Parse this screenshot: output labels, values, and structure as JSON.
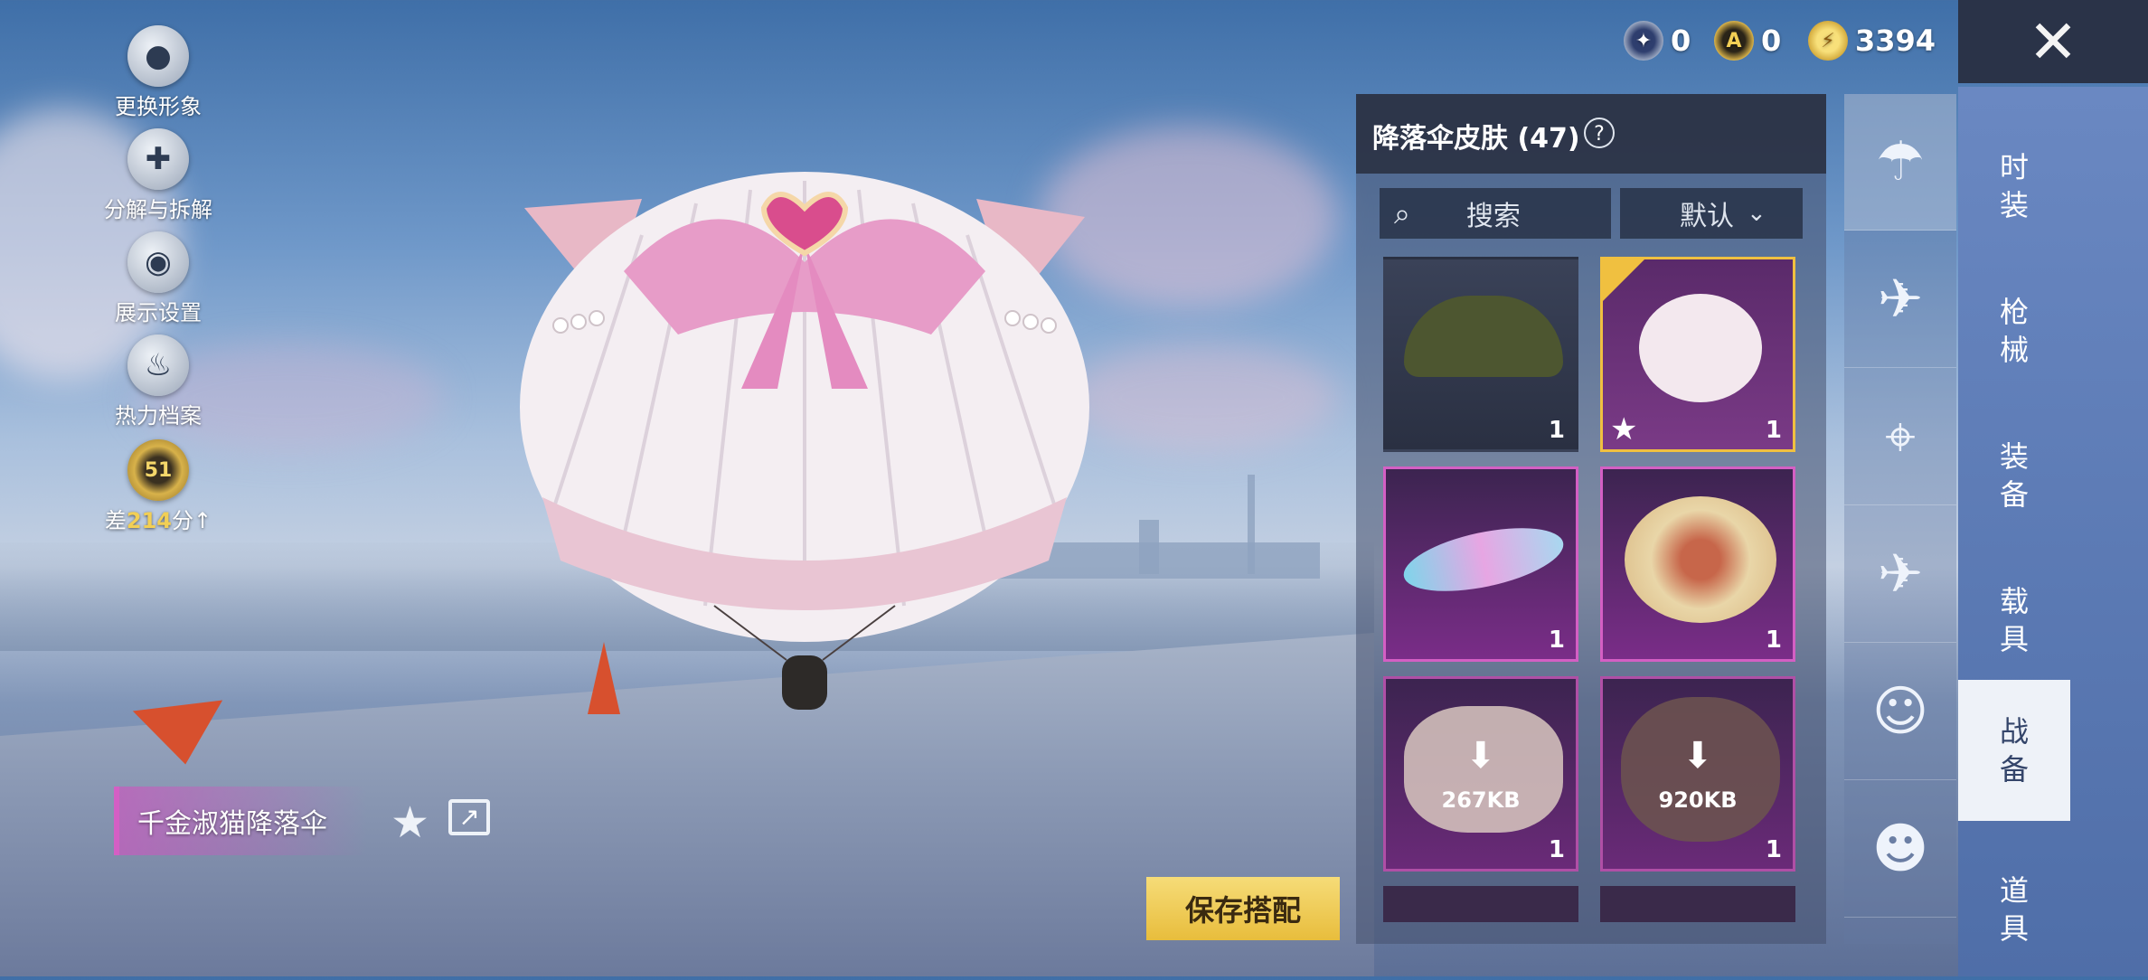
{
  "left_menu": {
    "change_avatar": "更换形象",
    "decompose": "分解与拆解",
    "display_settings": "展示设置",
    "heat_archive": "热力档案",
    "level_badge": "51",
    "level_gap_prefix": "差",
    "level_gap_value": "214",
    "level_gap_suffix": "分"
  },
  "currency": {
    "c1_value": "0",
    "c2_value": "0",
    "c3_value": "3394"
  },
  "item": {
    "name": "千金淑猫降落伞"
  },
  "panel": {
    "title": "降落伞皮肤 (47)",
    "help": "?",
    "search_label": "搜索",
    "sort_label": "默认"
  },
  "grid": [
    {
      "count": "1",
      "download": ""
    },
    {
      "count": "1",
      "download": ""
    },
    {
      "count": "1",
      "download": ""
    },
    {
      "count": "1",
      "download": ""
    },
    {
      "count": "1",
      "download": "267KB"
    },
    {
      "count": "1",
      "download": "920KB"
    }
  ],
  "save_button": "保存搭配",
  "categories": [
    {
      "label": "时\n装"
    },
    {
      "label": "枪\n械"
    },
    {
      "label": "装\n备"
    },
    {
      "label": "载\n具"
    },
    {
      "label": "战\n备"
    },
    {
      "label": "道\n具"
    }
  ],
  "colors": {
    "accent_gold": "#f2cf55",
    "accent_pink": "#d45fc4",
    "selected_border": "#f0c040"
  }
}
